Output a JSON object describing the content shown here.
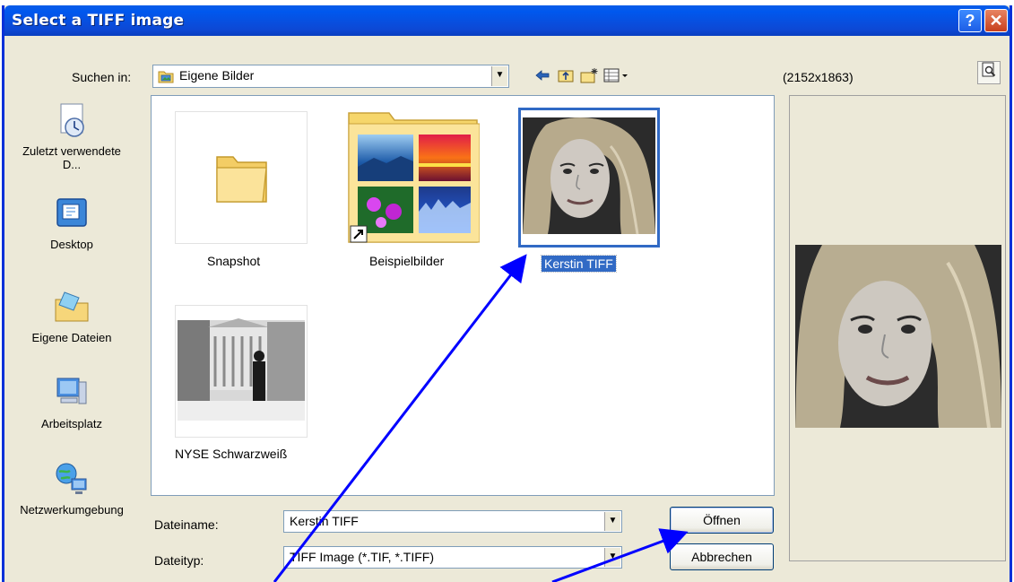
{
  "window": {
    "title": "Select a TIFF image",
    "help_label": "?",
    "close_label": "✕"
  },
  "lookin": {
    "label": "Suchen in:",
    "value": "Eigene Bilder"
  },
  "toolbar": {
    "icons": [
      "back-icon",
      "up-folder-icon",
      "new-folder-icon",
      "view-menu-icon"
    ]
  },
  "places": [
    {
      "label": "Zuletzt verwendete D...",
      "icon": "recent-documents-icon"
    },
    {
      "label": "Desktop",
      "icon": "desktop-icon"
    },
    {
      "label": "Eigene Dateien",
      "icon": "my-documents-icon"
    },
    {
      "label": "Arbeitsplatz",
      "icon": "my-computer-icon"
    },
    {
      "label": "Netzwerkumgebung",
      "icon": "network-icon"
    }
  ],
  "files": [
    {
      "label": "Snapshot",
      "type": "folder"
    },
    {
      "label": "Beispielbilder",
      "type": "folder-shortcut"
    },
    {
      "label": "Kerstin TIFF",
      "type": "image",
      "selected": true
    },
    {
      "label": "NYSE Schwarzweiß",
      "type": "image"
    }
  ],
  "filename": {
    "label": "Dateiname:",
    "value": "Kerstin TIFF"
  },
  "filetype": {
    "label": "Dateityp:",
    "value": "TIFF Image (*.TIF, *.TIFF)"
  },
  "buttons": {
    "open": "Öffnen",
    "cancel": "Abbrechen"
  },
  "preview": {
    "dimensions": "(2152x1863)"
  },
  "colors": {
    "titlebar": "#0058ee",
    "selection": "#316ac5",
    "annotation_arrow": "#0000ff"
  }
}
